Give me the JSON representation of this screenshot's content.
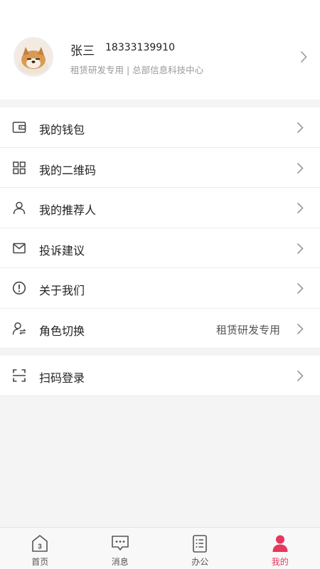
{
  "profile": {
    "name": "张三",
    "phone": "18333139910",
    "subtitle": "租赁研发专用 | 总部信息科技中心"
  },
  "menu_group_1": [
    {
      "label": "我的钱包",
      "icon": "wallet-icon"
    },
    {
      "label": "我的二维码",
      "icon": "qrcode-icon"
    },
    {
      "label": "我的推荐人",
      "icon": "person-icon"
    },
    {
      "label": "投诉建议",
      "icon": "mail-icon"
    },
    {
      "label": "关于我们",
      "icon": "info-icon"
    },
    {
      "label": "角色切换",
      "value": "租赁研发专用",
      "icon": "role-switch-icon"
    }
  ],
  "menu_group_2": [
    {
      "label": "扫码登录",
      "icon": "scan-icon"
    }
  ],
  "tabbar": {
    "items": [
      {
        "label": "首页",
        "icon": "home-icon"
      },
      {
        "label": "消息",
        "icon": "message-icon"
      },
      {
        "label": "办公",
        "icon": "office-list-icon"
      },
      {
        "label": "我的",
        "icon": "profile-icon",
        "active": true
      }
    ]
  },
  "colors": {
    "accent": "#e8365d",
    "background": "#f4f4f4",
    "icon": "#444444"
  }
}
